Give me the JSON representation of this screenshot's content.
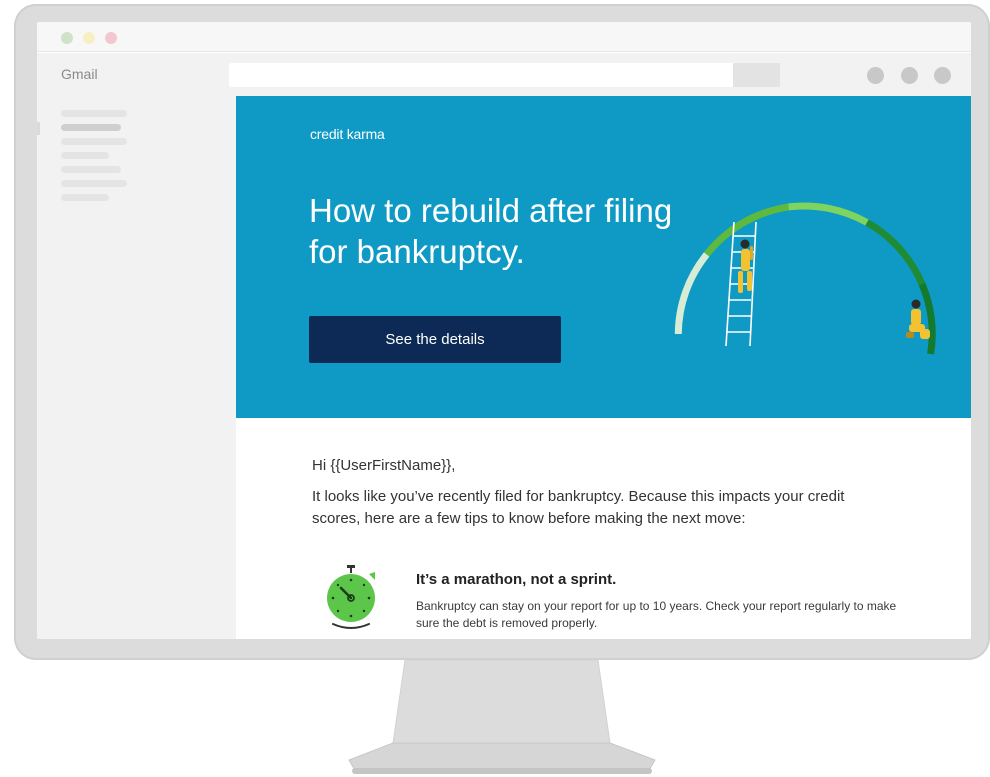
{
  "window": {
    "app_name": "Gmail"
  },
  "email": {
    "brand": "credit karma",
    "headline": "How to rebuild after filing for bankruptcy.",
    "cta_label": "See the details",
    "greeting": "Hi {{UserFirstName}},",
    "intro": "It looks like you’ve recently filed for bankruptcy. Because this impacts your credit scores, here are a few tips to know before making the next move:",
    "tips": [
      {
        "icon": "stopwatch-icon",
        "title": "It’s a marathon, not a sprint.",
        "body": "Bankruptcy can stay on your report for up to 10 years. Check your report regularly to make sure the debt is removed properly."
      }
    ]
  },
  "colors": {
    "hero_blue": "#0e9ac4",
    "cta_navy": "#0c2a55",
    "gauge_light": "#d6ecd4",
    "gauge_green": "#5fb93f",
    "gauge_dark": "#137a2e",
    "figure_yellow": "#f2c230",
    "stopwatch_green": "#5cc64a"
  }
}
